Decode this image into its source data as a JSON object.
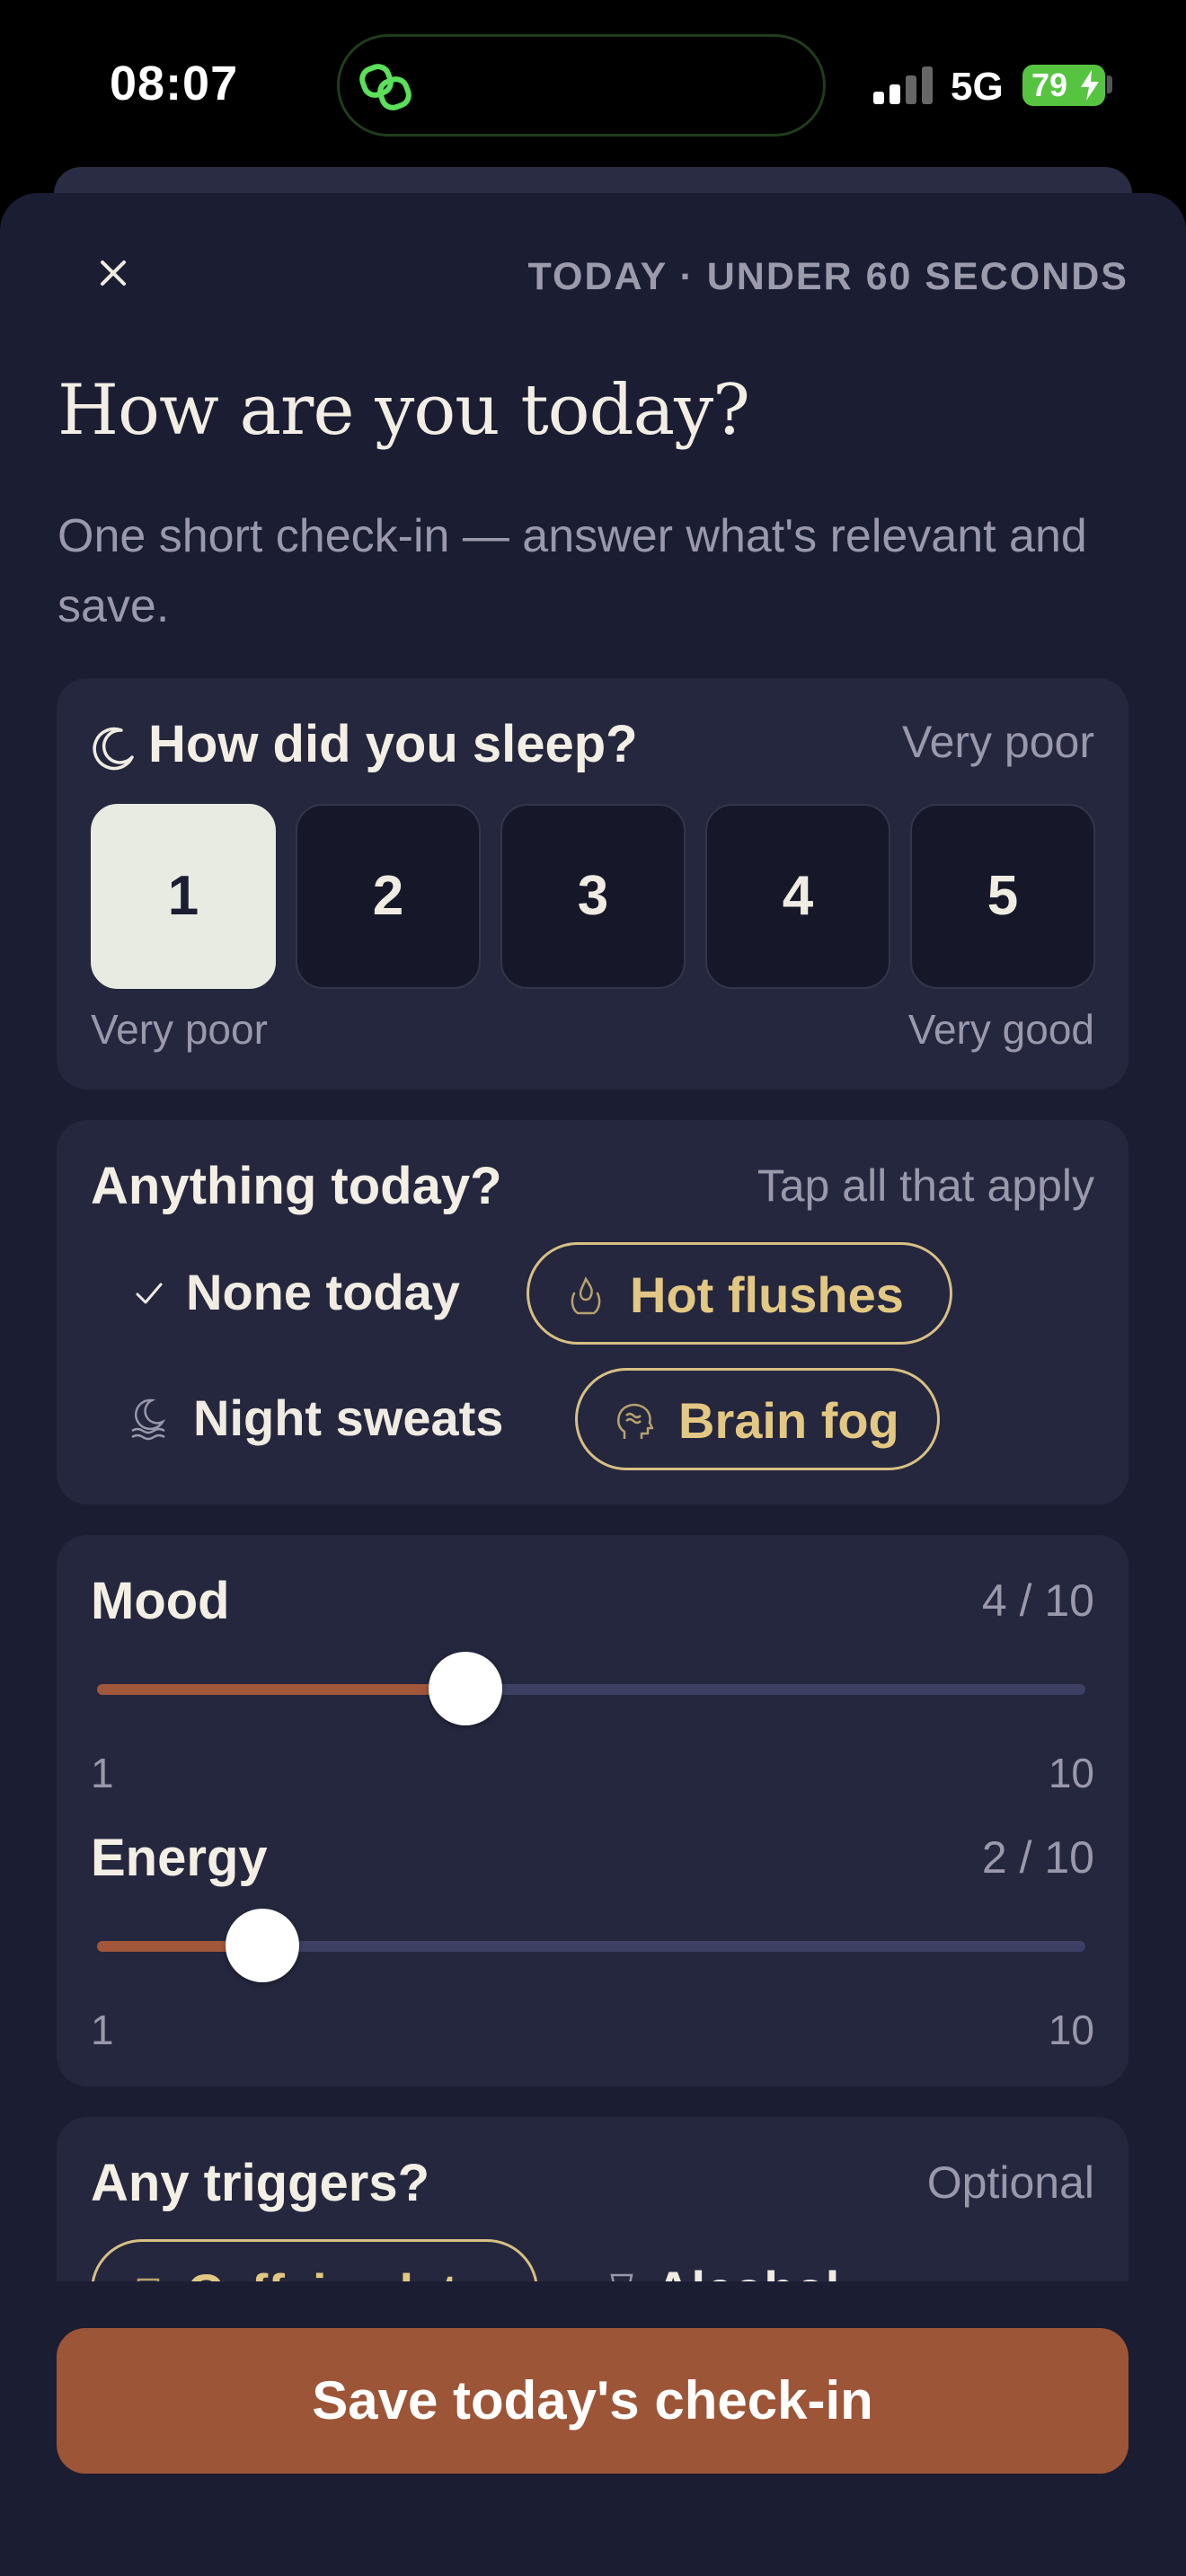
{
  "status_bar": {
    "time": "08:07",
    "network": "5G",
    "battery": "79"
  },
  "header": {
    "eyebrow": "TODAY · UNDER 60 SECONDS",
    "title": "How are you today?",
    "subtitle": "One short check-in — answer what's relevant and save."
  },
  "sleep": {
    "title": "How did you sleep?",
    "selected_label": "Very poor",
    "options": [
      "1",
      "2",
      "3",
      "4",
      "5"
    ],
    "selected": 1,
    "min_label": "Very poor",
    "max_label": "Very good"
  },
  "symptoms": {
    "title": "Anything today?",
    "hint": "Tap all that apply",
    "chips": [
      {
        "label": "None today",
        "icon": "check-icon",
        "selected": false
      },
      {
        "label": "Hot flushes",
        "icon": "flame-hands-icon",
        "selected": true
      },
      {
        "label": "Night sweats",
        "icon": "moon-wave-icon",
        "selected": false
      },
      {
        "label": "Brain fog",
        "icon": "head-fog-icon",
        "selected": true
      }
    ]
  },
  "sliders": {
    "mood": {
      "label": "Mood",
      "value_text": "4 / 10",
      "value": 4,
      "min": "1",
      "max": "10"
    },
    "energy": {
      "label": "Energy",
      "value_text": "2 / 10",
      "value": 2,
      "min": "1",
      "max": "10"
    }
  },
  "triggers": {
    "title": "Any triggers?",
    "hint": "Optional",
    "chips": [
      {
        "label": "Caffeine late",
        "icon": "cup-icon",
        "selected": true
      },
      {
        "label": "Alcohol",
        "icon": "glass-icon",
        "selected": false
      }
    ]
  },
  "footer": {
    "save_label": "Save today's check-in"
  },
  "colors": {
    "background": "#1b1d33",
    "card": "#25273e",
    "accent": "#9d5537",
    "chip_selected": "#d8c084",
    "slider_fill": "#a0573a"
  }
}
